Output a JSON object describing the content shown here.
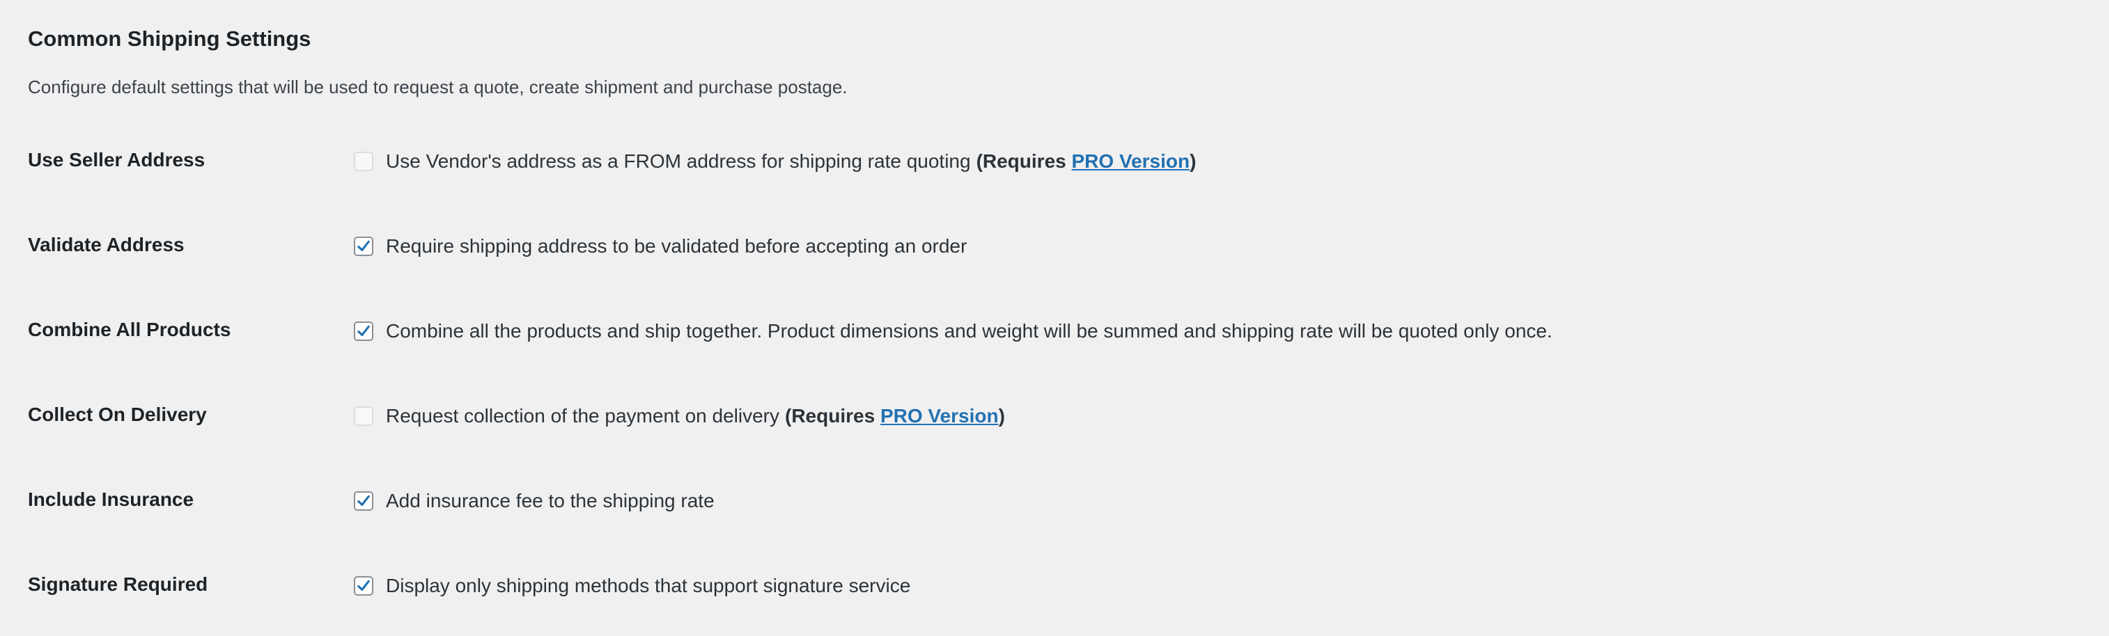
{
  "section": {
    "title": "Common Shipping Settings",
    "description": "Configure default settings that will be used to request a quote, create shipment and purchase postage."
  },
  "settings": [
    {
      "label": "Use Seller Address",
      "text": "Use Vendor's address as a FROM address for shipping rate quoting",
      "checked": false,
      "disabled": true,
      "requires_prefix": "(Requires ",
      "requires_link": "PRO Version",
      "requires_suffix": ")"
    },
    {
      "label": "Validate Address",
      "text": "Require shipping address to be validated before accepting an order",
      "checked": true,
      "disabled": false
    },
    {
      "label": "Combine All Products",
      "text": "Combine all the products and ship together. Product dimensions and weight will be summed and shipping rate will be quoted only once.",
      "checked": true,
      "disabled": false
    },
    {
      "label": "Collect On Delivery",
      "text": "Request collection of the payment on delivery",
      "checked": false,
      "disabled": true,
      "requires_prefix": "(Requires ",
      "requires_link": "PRO Version",
      "requires_suffix": ")"
    },
    {
      "label": "Include Insurance",
      "text": "Add insurance fee to the shipping rate",
      "checked": true,
      "disabled": false
    },
    {
      "label": "Signature Required",
      "text": "Display only shipping methods that support signature service",
      "checked": true,
      "disabled": false
    }
  ],
  "colors": {
    "background": "#f0f0f1",
    "link": "#2271b1",
    "checkmark": "#2271b1"
  }
}
